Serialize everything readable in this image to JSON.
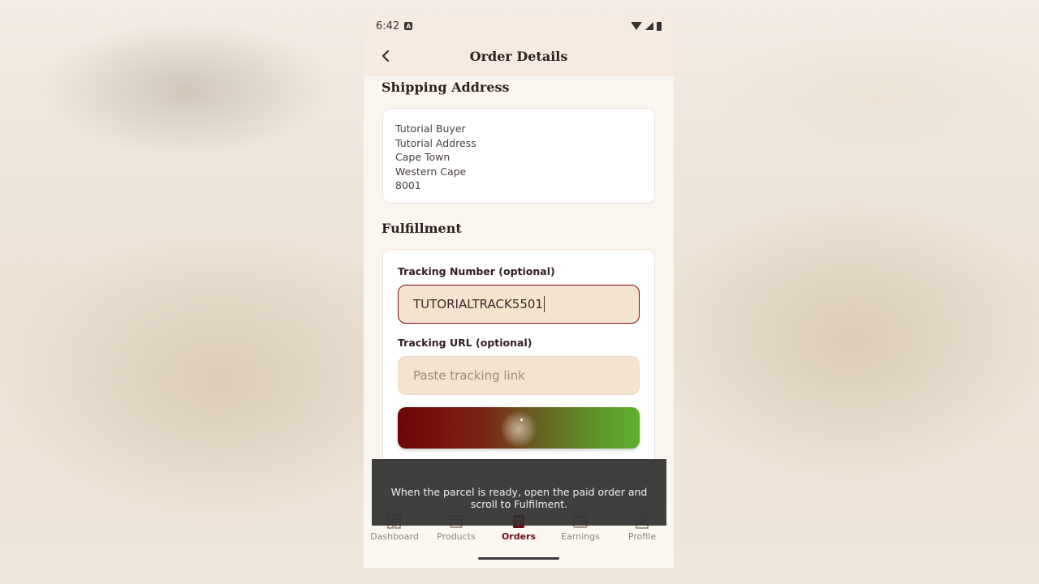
{
  "status_bar": {
    "time": "6:42"
  },
  "app_bar": {
    "title": "Order Details"
  },
  "shipping": {
    "title": "Shipping Address",
    "lines": [
      "Tutorial Buyer",
      "Tutorial Address",
      "Cape Town",
      "Western Cape",
      "8001"
    ]
  },
  "fulfillment": {
    "title": "Fulfillment",
    "tracking_number_label": "Tracking Number (optional)",
    "tracking_number_value": "TUTORIALTRACK5501",
    "tracking_url_label": "Tracking URL (optional)",
    "tracking_url_placeholder": "Paste tracking link"
  },
  "toast": {
    "message": "When the parcel is ready, open the paid order and scroll to Fulfilment."
  },
  "nav": {
    "items": [
      {
        "label": "Dashboard",
        "icon": "dashboard-icon"
      },
      {
        "label": "Products",
        "icon": "archive-box-icon"
      },
      {
        "label": "Orders",
        "icon": "receipt-icon"
      },
      {
        "label": "Earnings",
        "icon": "wallet-icon"
      },
      {
        "label": "Profile",
        "icon": "person-icon"
      }
    ],
    "active": "Orders"
  },
  "colors": {
    "accent": "#6d0a12",
    "field_bg": "#f3e3cf",
    "button_gradient_start": "#6f0408",
    "button_gradient_end": "#5eae2e"
  }
}
